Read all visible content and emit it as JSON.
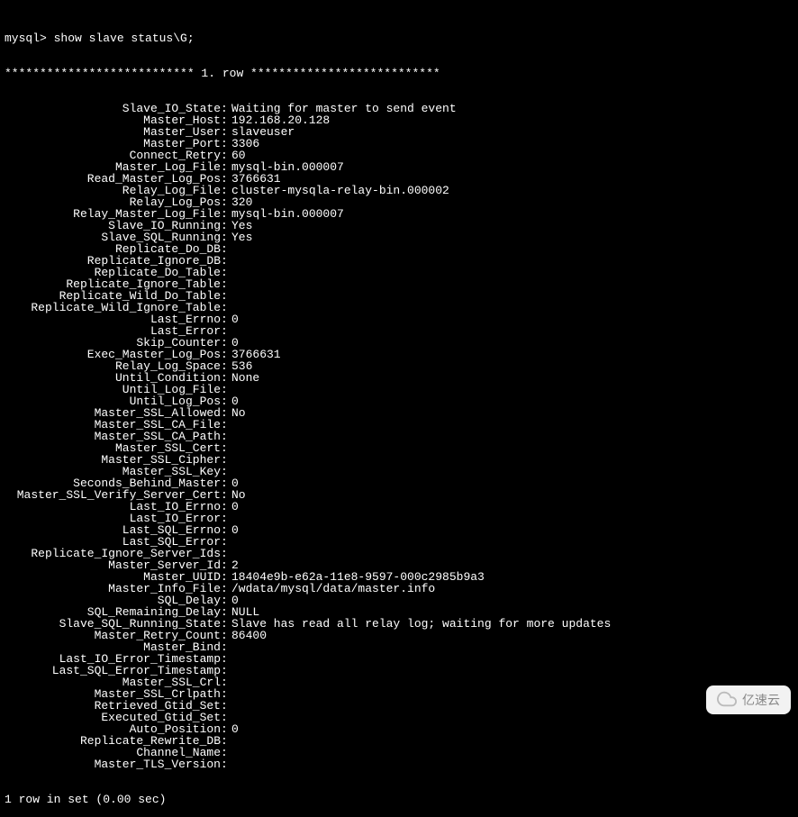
{
  "prompt": "mysql> show slave status\\G;",
  "row_header": "*************************** 1. row ***************************",
  "footer": "1 row in set (0.00 sec)",
  "watermark": "亿速云",
  "fields": [
    {
      "label": "Slave_IO_State",
      "value": "Waiting for master to send event"
    },
    {
      "label": "Master_Host",
      "value": "192.168.20.128"
    },
    {
      "label": "Master_User",
      "value": "slaveuser"
    },
    {
      "label": "Master_Port",
      "value": "3306"
    },
    {
      "label": "Connect_Retry",
      "value": "60"
    },
    {
      "label": "Master_Log_File",
      "value": "mysql-bin.000007"
    },
    {
      "label": "Read_Master_Log_Pos",
      "value": "3766631"
    },
    {
      "label": "Relay_Log_File",
      "value": "cluster-mysqla-relay-bin.000002"
    },
    {
      "label": "Relay_Log_Pos",
      "value": "320"
    },
    {
      "label": "Relay_Master_Log_File",
      "value": "mysql-bin.000007"
    },
    {
      "label": "Slave_IO_Running",
      "value": "Yes"
    },
    {
      "label": "Slave_SQL_Running",
      "value": "Yes"
    },
    {
      "label": "Replicate_Do_DB",
      "value": ""
    },
    {
      "label": "Replicate_Ignore_DB",
      "value": ""
    },
    {
      "label": "Replicate_Do_Table",
      "value": ""
    },
    {
      "label": "Replicate_Ignore_Table",
      "value": ""
    },
    {
      "label": "Replicate_Wild_Do_Table",
      "value": ""
    },
    {
      "label": "Replicate_Wild_Ignore_Table",
      "value": ""
    },
    {
      "label": "Last_Errno",
      "value": "0"
    },
    {
      "label": "Last_Error",
      "value": ""
    },
    {
      "label": "Skip_Counter",
      "value": "0"
    },
    {
      "label": "Exec_Master_Log_Pos",
      "value": "3766631"
    },
    {
      "label": "Relay_Log_Space",
      "value": "536"
    },
    {
      "label": "Until_Condition",
      "value": "None"
    },
    {
      "label": "Until_Log_File",
      "value": ""
    },
    {
      "label": "Until_Log_Pos",
      "value": "0"
    },
    {
      "label": "Master_SSL_Allowed",
      "value": "No"
    },
    {
      "label": "Master_SSL_CA_File",
      "value": ""
    },
    {
      "label": "Master_SSL_CA_Path",
      "value": ""
    },
    {
      "label": "Master_SSL_Cert",
      "value": ""
    },
    {
      "label": "Master_SSL_Cipher",
      "value": ""
    },
    {
      "label": "Master_SSL_Key",
      "value": ""
    },
    {
      "label": "Seconds_Behind_Master",
      "value": "0"
    },
    {
      "label": "Master_SSL_Verify_Server_Cert",
      "value": "No"
    },
    {
      "label": "Last_IO_Errno",
      "value": "0"
    },
    {
      "label": "Last_IO_Error",
      "value": ""
    },
    {
      "label": "Last_SQL_Errno",
      "value": "0"
    },
    {
      "label": "Last_SQL_Error",
      "value": ""
    },
    {
      "label": "Replicate_Ignore_Server_Ids",
      "value": ""
    },
    {
      "label": "Master_Server_Id",
      "value": "2"
    },
    {
      "label": "Master_UUID",
      "value": "18404e9b-e62a-11e8-9597-000c2985b9a3"
    },
    {
      "label": "Master_Info_File",
      "value": "/wdata/mysql/data/master.info"
    },
    {
      "label": "SQL_Delay",
      "value": "0"
    },
    {
      "label": "SQL_Remaining_Delay",
      "value": "NULL"
    },
    {
      "label": "Slave_SQL_Running_State",
      "value": "Slave has read all relay log; waiting for more updates"
    },
    {
      "label": "Master_Retry_Count",
      "value": "86400"
    },
    {
      "label": "Master_Bind",
      "value": ""
    },
    {
      "label": "Last_IO_Error_Timestamp",
      "value": ""
    },
    {
      "label": "Last_SQL_Error_Timestamp",
      "value": ""
    },
    {
      "label": "Master_SSL_Crl",
      "value": ""
    },
    {
      "label": "Master_SSL_Crlpath",
      "value": ""
    },
    {
      "label": "Retrieved_Gtid_Set",
      "value": ""
    },
    {
      "label": "Executed_Gtid_Set",
      "value": ""
    },
    {
      "label": "Auto_Position",
      "value": "0"
    },
    {
      "label": "Replicate_Rewrite_DB",
      "value": ""
    },
    {
      "label": "Channel_Name",
      "value": ""
    },
    {
      "label": "Master_TLS_Version",
      "value": ""
    }
  ]
}
